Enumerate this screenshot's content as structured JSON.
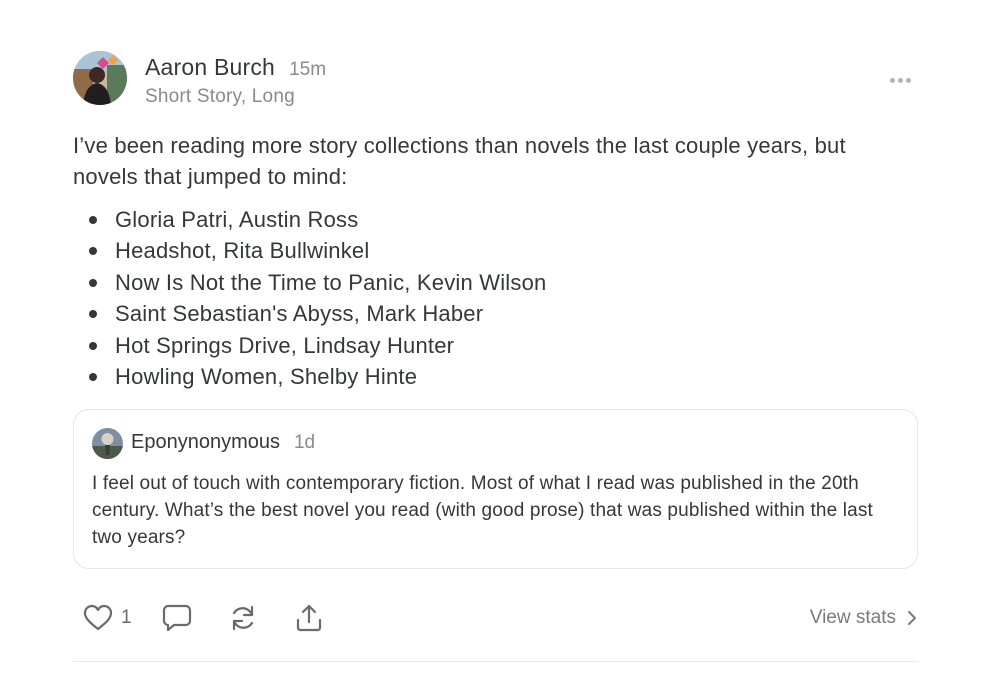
{
  "post": {
    "author": "Aaron Burch",
    "time": "15m",
    "subtitle": "Short Story, Long",
    "body": "I’ve been reading more story collections than novels the last couple years, but novels that jumped to mind:",
    "books": [
      "Gloria Patri, Austin Ross",
      "Headshot, Rita Bullwinkel",
      "Now Is Not the Time to Panic, Kevin Wilson",
      "Saint Sebastian's Abyss, Mark Haber",
      "Hot Springs Drive, Lindsay Hunter",
      "Howling Women, Shelby Hinte"
    ]
  },
  "quoted": {
    "author": "Eponynonymous",
    "time": "1d",
    "text": "I feel out of touch with contemporary fiction. Most of what I read was published in the 20th century. What’s the best novel you read (with good prose) that was published within the last two years?"
  },
  "actions": {
    "like_count": "1",
    "view_stats": "View stats",
    "icons": [
      "heart-icon",
      "comment-icon",
      "restack-icon",
      "share-icon",
      "chevron-right-icon",
      "more-icon"
    ]
  },
  "colors": {
    "text": "#363737",
    "muted": "#8a8a8a",
    "border": "#e6e6e6"
  }
}
